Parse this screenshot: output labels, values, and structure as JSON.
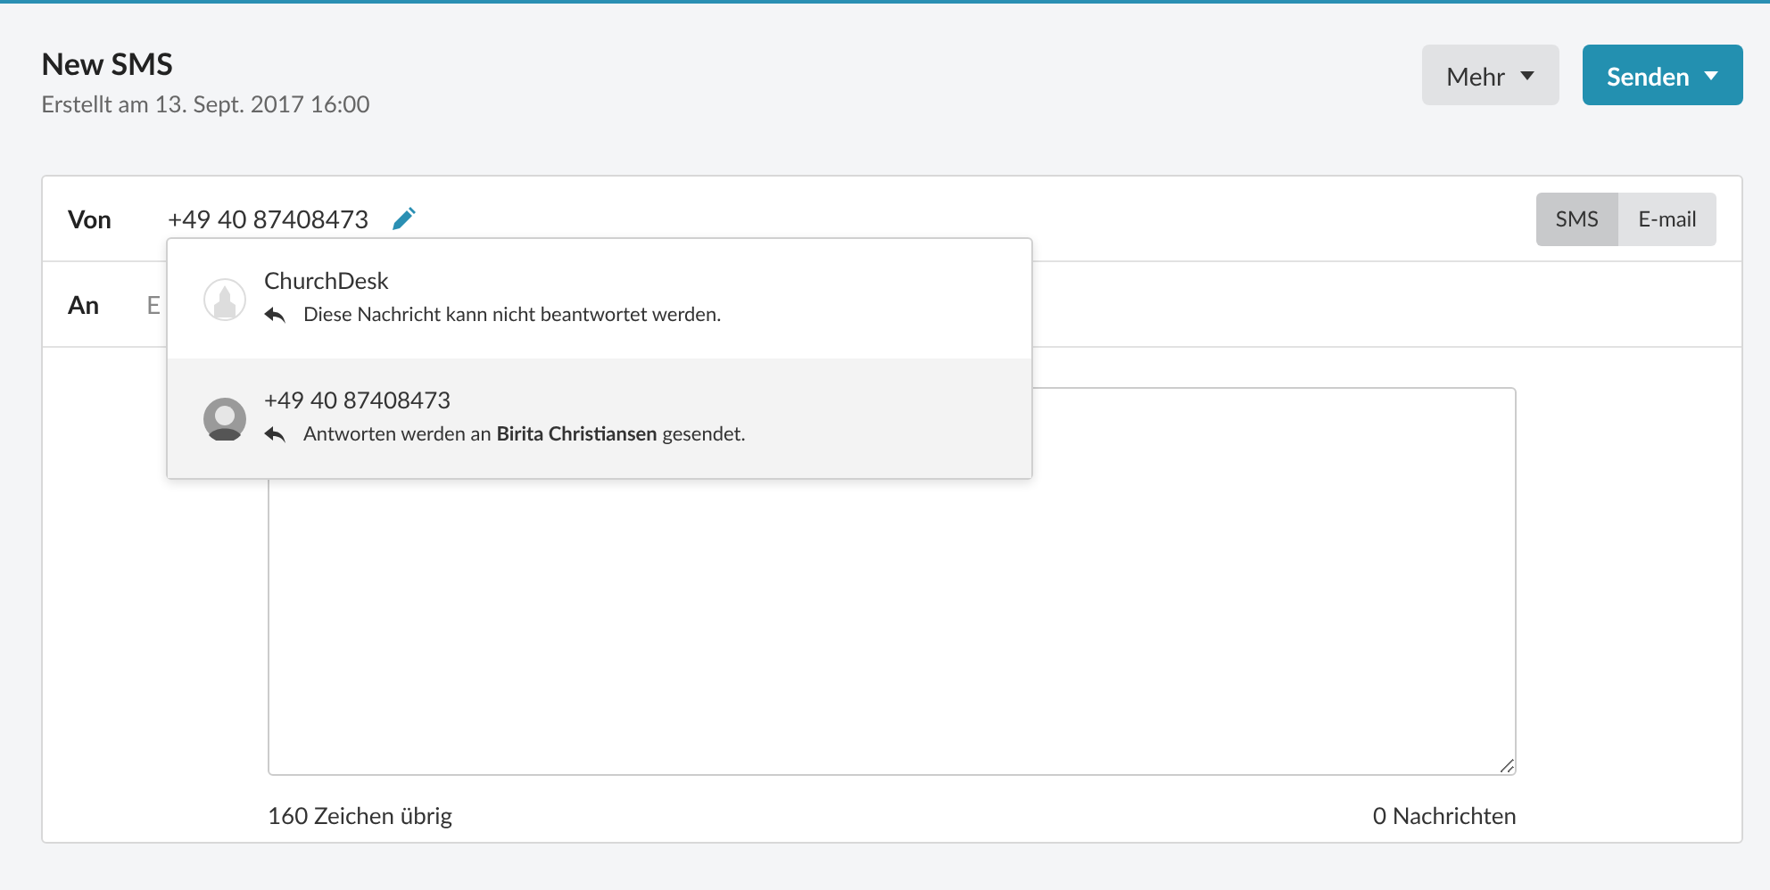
{
  "header": {
    "title": "New SMS",
    "subtitle": "Erstellt am 13. Sept. 2017 16:00"
  },
  "actions": [
    {
      "label": "Mehr",
      "kind": "secondary"
    },
    {
      "label": "Senden",
      "kind": "primary"
    }
  ],
  "from": {
    "label": "Von",
    "value": "+49 40 87408473"
  },
  "channel_toggle": [
    {
      "label": "SMS",
      "selected": true
    },
    {
      "label": "E-mail",
      "selected": false
    }
  ],
  "to": {
    "label": "An",
    "value": "E"
  },
  "sender_dropdown": [
    {
      "name": "ChurchDesk",
      "kind": "church",
      "note": "Diese Nachricht kann nicht beantwortet werden.",
      "selected": false
    },
    {
      "name": "+49 40 87408473",
      "kind": "person",
      "note": "Antworten werden an **Birita Christiansen** gesendet.",
      "selected": true
    }
  ],
  "message": {
    "chars_left": "160 Zeichen übrig",
    "count": "0 Nachrichten"
  }
}
